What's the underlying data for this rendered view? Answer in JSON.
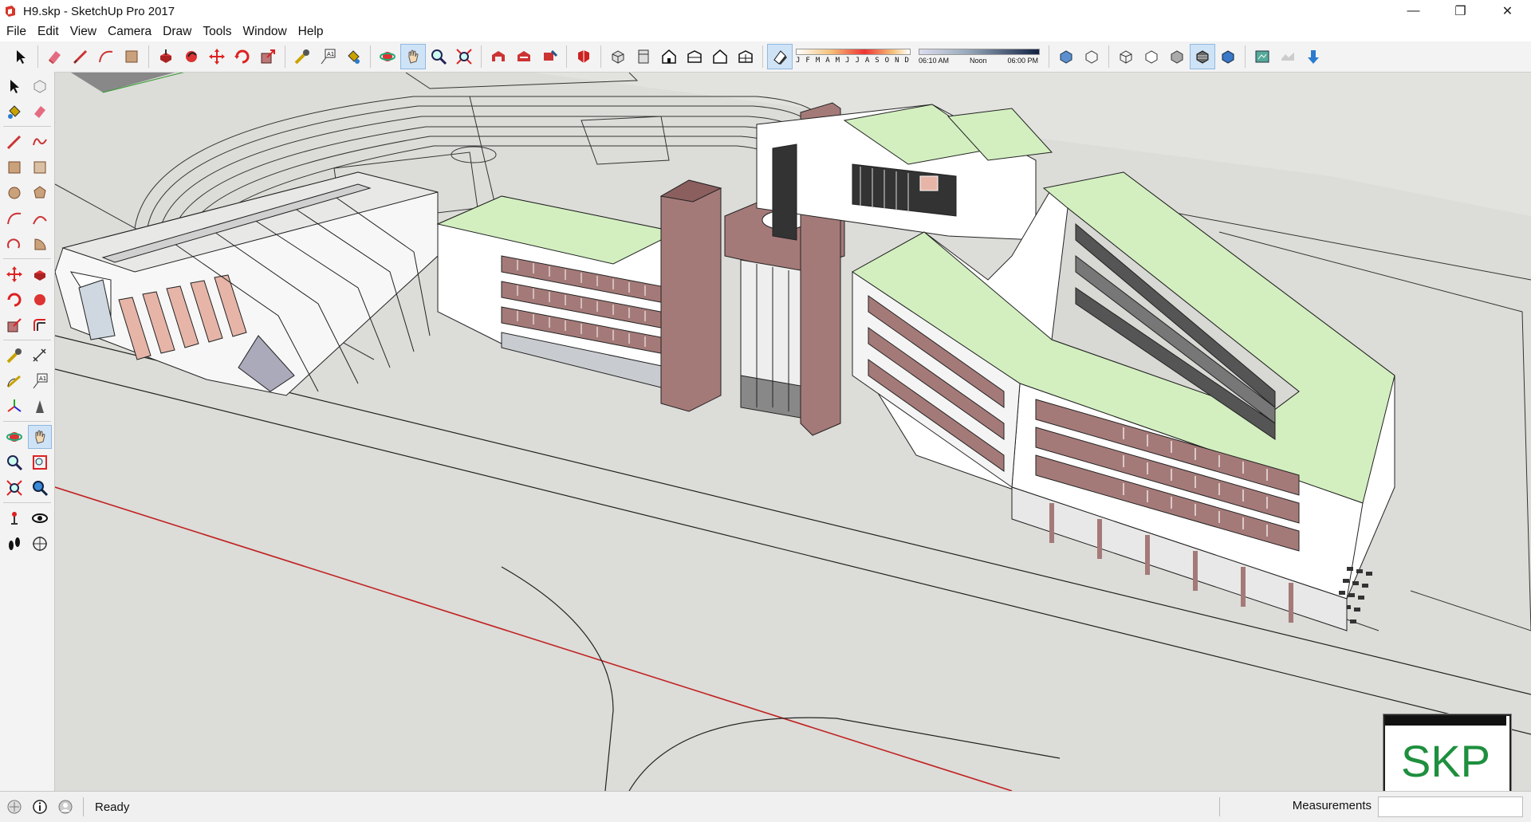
{
  "window": {
    "title": "H9.skp - SketchUp Pro 2017",
    "controls": [
      "—",
      "❐",
      "✕"
    ]
  },
  "menu": [
    "File",
    "Edit",
    "View",
    "Camera",
    "Draw",
    "Tools",
    "Window",
    "Help"
  ],
  "toolbar": {
    "months": [
      "J",
      "F",
      "M",
      "A",
      "M",
      "J",
      "J",
      "A",
      "S",
      "O",
      "N",
      "D"
    ],
    "time_labels": [
      "06:10 AM",
      "Noon",
      "06:00 PM"
    ]
  },
  "status": {
    "text": "Ready",
    "measurements_label": "Measurements",
    "measurements_value": ""
  },
  "watermark": "SKP",
  "colors": {
    "roof": "#d3efc0",
    "wall": "#ffffff",
    "accent_brick": "#a47a78",
    "ground": "#dcdcd8",
    "axis_red": "#c02020",
    "axis_green": "#2a9a2a",
    "watermark_green": "#1e8f3e"
  }
}
